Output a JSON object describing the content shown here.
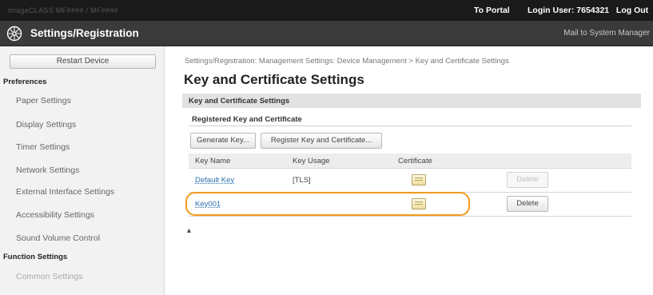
{
  "topbar": {
    "model": "imageCLASS   MF####  /  MF####",
    "portal": "To Portal",
    "login_label": "Login User:",
    "login_user": "7654321",
    "logout": "Log Out"
  },
  "header": {
    "icon": "gear-wheel-icon",
    "title": "Settings/Registration",
    "mail": "Mail to System Manager"
  },
  "sidebar": {
    "restart": "Restart Device",
    "preferences": "Preferences",
    "items": [
      "Paper Settings",
      "Display Settings",
      "Timer Settings",
      "Network Settings",
      "External Interface Settings",
      "Accessibility Settings",
      "Sound Volume Control"
    ],
    "function_settings": "Function Settings",
    "common": "Common Settings"
  },
  "main": {
    "breadcrumb": "Settings/Registration: Management Settings: Device Management > Key and Certificate Settings",
    "title": "Key and Certificate Settings",
    "section": "Key and Certificate Settings",
    "subheading": "Registered Key and Certificate",
    "buttons": {
      "generate": "Generate Key...",
      "register": "Register Key and Certificate..."
    },
    "table": {
      "headers": [
        "Key Name",
        "Key Usage",
        "Certificate"
      ],
      "rows": [
        {
          "name": "Default Key",
          "usage": "[TLS]",
          "delete": "Delete",
          "delete_enabled": false
        },
        {
          "name": "Key001",
          "usage": "",
          "delete": "Delete",
          "delete_enabled": true
        }
      ]
    },
    "collapse": "▲"
  },
  "colors": {
    "highlight": "#f39a1e",
    "link": "#2e6fb0",
    "header_bg": "#3a3a3a"
  }
}
